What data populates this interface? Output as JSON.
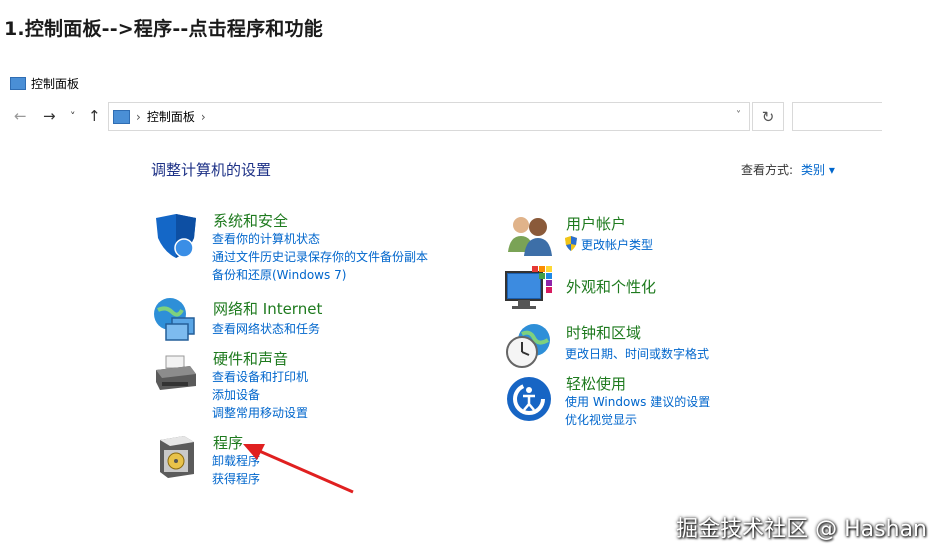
{
  "heading": "1.控制面板-->程序--点击程序和功能",
  "window_title": "控制面板",
  "nav": {
    "back": "←",
    "forward": "→",
    "recent": "˅",
    "up": "↑"
  },
  "address": {
    "separator1": "›",
    "path": "控制面板",
    "separator2": "›",
    "dropdown": "˅"
  },
  "refresh": "↻",
  "search": {
    "placeholder": ""
  },
  "page_title": "调整计算机的设置",
  "view_by": {
    "label": "查看方式:",
    "value": "类别 ▾"
  },
  "left_categories": [
    {
      "title": "系统和安全",
      "icon": "shield-icon",
      "links": [
        "查看你的计算机状态",
        "通过文件历史记录保存你的文件备份副本",
        "备份和还原(Windows 7)"
      ]
    },
    {
      "title": "网络和 Internet",
      "icon": "network-globe-icon",
      "links": [
        "查看网络状态和任务"
      ]
    },
    {
      "title": "硬件和声音",
      "icon": "printer-icon",
      "links": [
        "查看设备和打印机",
        "添加设备",
        "调整常用移动设置"
      ]
    },
    {
      "title": "程序",
      "icon": "programs-icon",
      "links": [
        "卸载程序",
        "获得程序"
      ]
    }
  ],
  "right_categories": [
    {
      "title": "用户帐户",
      "icon": "users-icon",
      "links": [
        "更改帐户类型"
      ]
    },
    {
      "title": "外观和个性化",
      "icon": "monitor-palette-icon",
      "links": []
    },
    {
      "title": "时钟和区域",
      "icon": "clock-globe-icon",
      "links": [
        "更改日期、时间或数字格式"
      ]
    },
    {
      "title": "轻松使用",
      "icon": "ease-of-access-icon",
      "links": [
        "使用 Windows 建议的设置",
        "优化视觉显示"
      ]
    }
  ],
  "watermark": "掘金技术社区 @ Hashan",
  "colors": {
    "title_green": "#1e7a1e",
    "link_blue": "#0066cc",
    "page_title_blue": "#1e3287",
    "arrow_red": "#e02020"
  }
}
